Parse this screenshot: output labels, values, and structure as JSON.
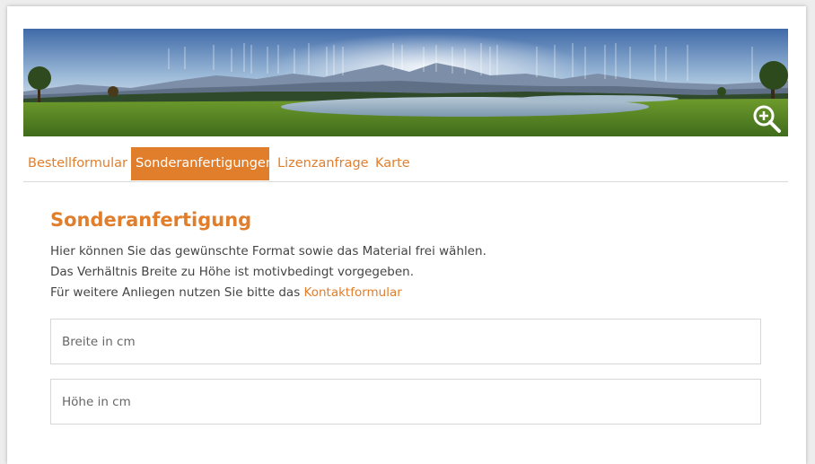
{
  "colors": {
    "accent": "#e07e2c",
    "text": "#444444"
  },
  "banner": {
    "zoom_icon": "zoom-in-icon"
  },
  "tabs": [
    {
      "label": "Bestellformular",
      "active": false
    },
    {
      "label": "Sonderanfertigungen",
      "active": true
    },
    {
      "label": "Lizenzanfrage",
      "active": false
    },
    {
      "label": "Karte",
      "active": false
    }
  ],
  "content": {
    "title": "Sonderanfertigung",
    "line1": "Hier können Sie das gewünschte Format sowie das Material frei wählen.",
    "line2": "Das Verhältnis Breite zu Höhe ist motivbedingt vorgegeben.",
    "line3_prefix": "Für weitere Anliegen nutzen Sie bitte das ",
    "line3_link": "Kontaktformular"
  },
  "form": {
    "width_placeholder": "Breite in cm",
    "height_placeholder": "Höhe in cm"
  }
}
